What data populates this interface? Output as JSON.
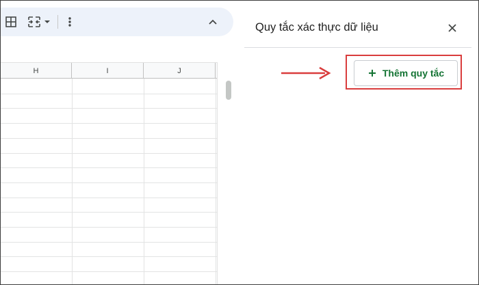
{
  "panel": {
    "title": "Quy tắc xác thực dữ liệu",
    "add_rule_label": "Thêm quy tắc"
  },
  "sheet": {
    "columns": [
      "H",
      "I",
      "J"
    ]
  },
  "icons": {
    "borders": "borders-icon",
    "merge": "merge-cells-icon",
    "dropdown": "chevron-down-icon",
    "more": "more-vertical-icon",
    "collapse": "chevron-up-icon",
    "close": "close-icon",
    "plus": "plus-icon",
    "arrow": "arrow-right-icon"
  },
  "colors": {
    "accent_green": "#137333",
    "highlight_red": "#d93c3c",
    "toolbar_bg": "#edf2fa"
  }
}
